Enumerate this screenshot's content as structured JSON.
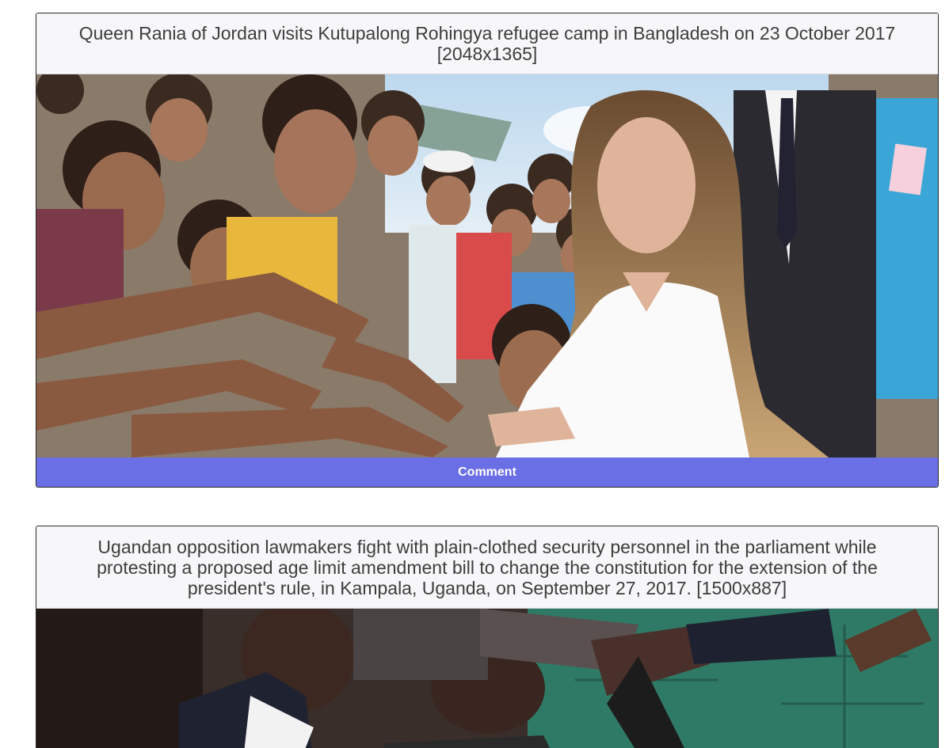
{
  "posts": [
    {
      "caption": "Queen Rania of Jordan visits Kutupalong Rohingya refugee camp in Bangladesh on 23 October 2017",
      "size": "[2048x1365]",
      "image_subject": "woman-greeting-crowd-of-children-photo",
      "comment_label": "Comment"
    },
    {
      "caption_lines": [
        "Ugandan opposition lawmakers fight with plain-clothed security personnel in the parliament while",
        "protesting a proposed age limit amendment bill to change the constitution for the extension of the",
        "president's rule, in Kampala, Uganda, on September 27, 2017. [1500x887]"
      ],
      "image_subject": "parliament-scuffle-photo"
    }
  ],
  "colors": {
    "button": "#6b6fe6",
    "caption_bg": "#f7f7f9",
    "caption_text": "#3d3d3d"
  }
}
